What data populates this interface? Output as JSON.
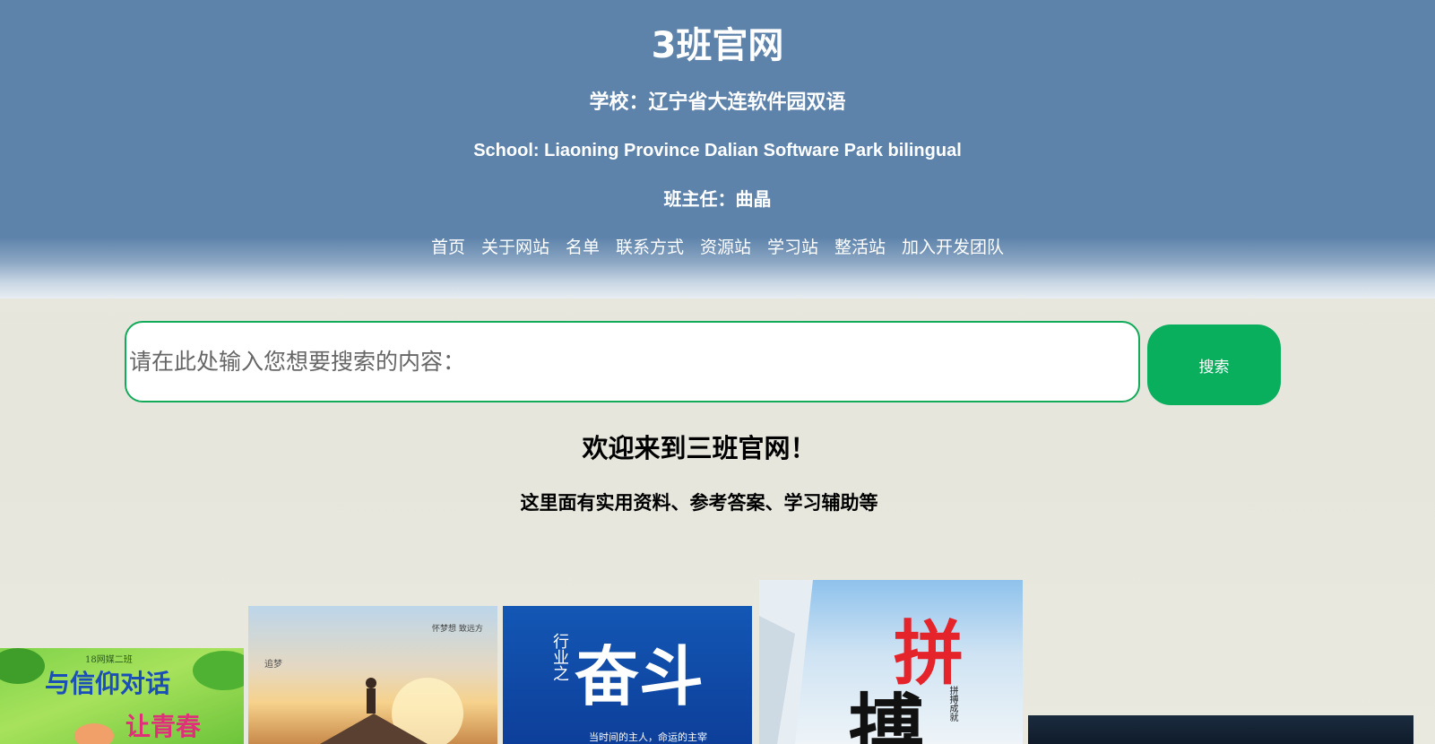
{
  "header": {
    "title": "3班官网",
    "school_cn": "学校：辽宁省大连软件园双语",
    "school_en": "School: Liaoning Province Dalian Software Park bilingual",
    "teacher": "班主任：曲晶"
  },
  "nav": {
    "items": [
      "首页",
      "关于网站",
      "名单",
      "联系方式",
      "资源站",
      "学习站",
      "整活站",
      "加入开发团队"
    ]
  },
  "search": {
    "placeholder": "请在此处输入您想要搜索的内容：",
    "value": "",
    "button_label": "搜索"
  },
  "welcome": {
    "title": "欢迎来到三班官网！",
    "subtitle": "这里面有实用资料、参考答案、学习辅助等"
  },
  "posters": {
    "p1": {
      "top": "18网媒二班",
      "main": "与信仰对话",
      "sub": "让青春"
    },
    "p2": {
      "top": "怀梦想 致远方",
      "side": "追梦"
    },
    "p3": {
      "side": "行业之",
      "main": "奋斗",
      "bottom": "当时间的主人，命运的主宰"
    },
    "p4": {
      "main1": "拼",
      "main2": "搏",
      "side": "拼搏成就"
    }
  },
  "colors": {
    "header_bg": "#5e83ab",
    "search_border": "#13aa5a",
    "search_button": "#0aaf5e"
  }
}
